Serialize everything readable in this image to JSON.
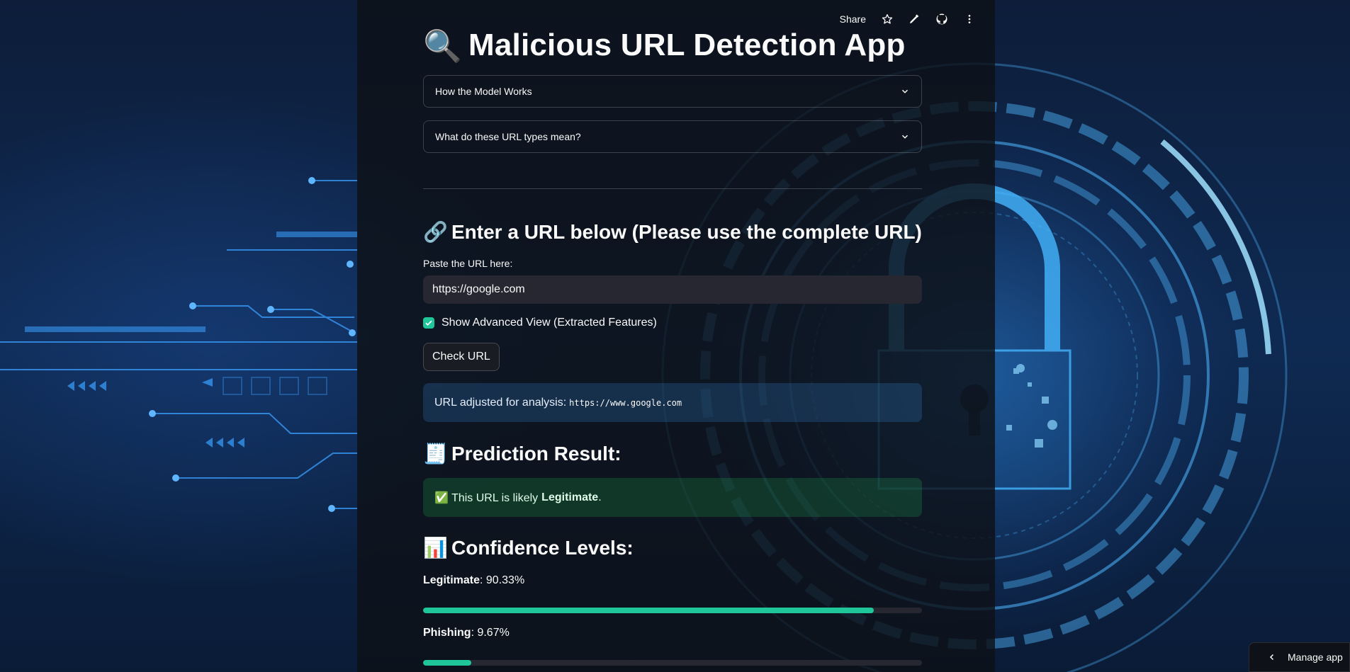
{
  "toolbar": {
    "share_label": "Share"
  },
  "header": {
    "title": "Malicious URL Detection App",
    "title_emoji": "🔍"
  },
  "expanders": [
    {
      "label": "How the Model Works"
    },
    {
      "label": "What do these URL types mean?"
    }
  ],
  "url_section": {
    "heading_emoji": "🔗",
    "heading": "Enter a URL below (Please use the complete URL)",
    "input_label": "Paste the URL here:",
    "input_value": "https://google.com",
    "advanced_checkbox_label": "Show Advanced View (Extracted Features)",
    "advanced_checked": true,
    "check_button_label": "Check URL"
  },
  "adjusted_notice": {
    "text": "URL adjusted for analysis:",
    "url": "https://www.google.com"
  },
  "prediction": {
    "heading_emoji": "🧾",
    "heading": "Prediction Result:",
    "prefix": "✅ This URL is likely",
    "verdict": "Legitimate",
    "suffix": "."
  },
  "confidence": {
    "heading_emoji": "📊",
    "heading": "Confidence Levels:",
    "items": [
      {
        "label": "Legitimate",
        "value_text": ": 90.33%",
        "value": 0.9033
      },
      {
        "label": "Phishing",
        "value_text": ": 9.67%",
        "value": 0.0967
      }
    ]
  },
  "manage_app": {
    "label": "Manage app"
  },
  "colors": {
    "accent": "#1fc69a",
    "panel": "#0e1117",
    "input_bg": "#262730"
  }
}
